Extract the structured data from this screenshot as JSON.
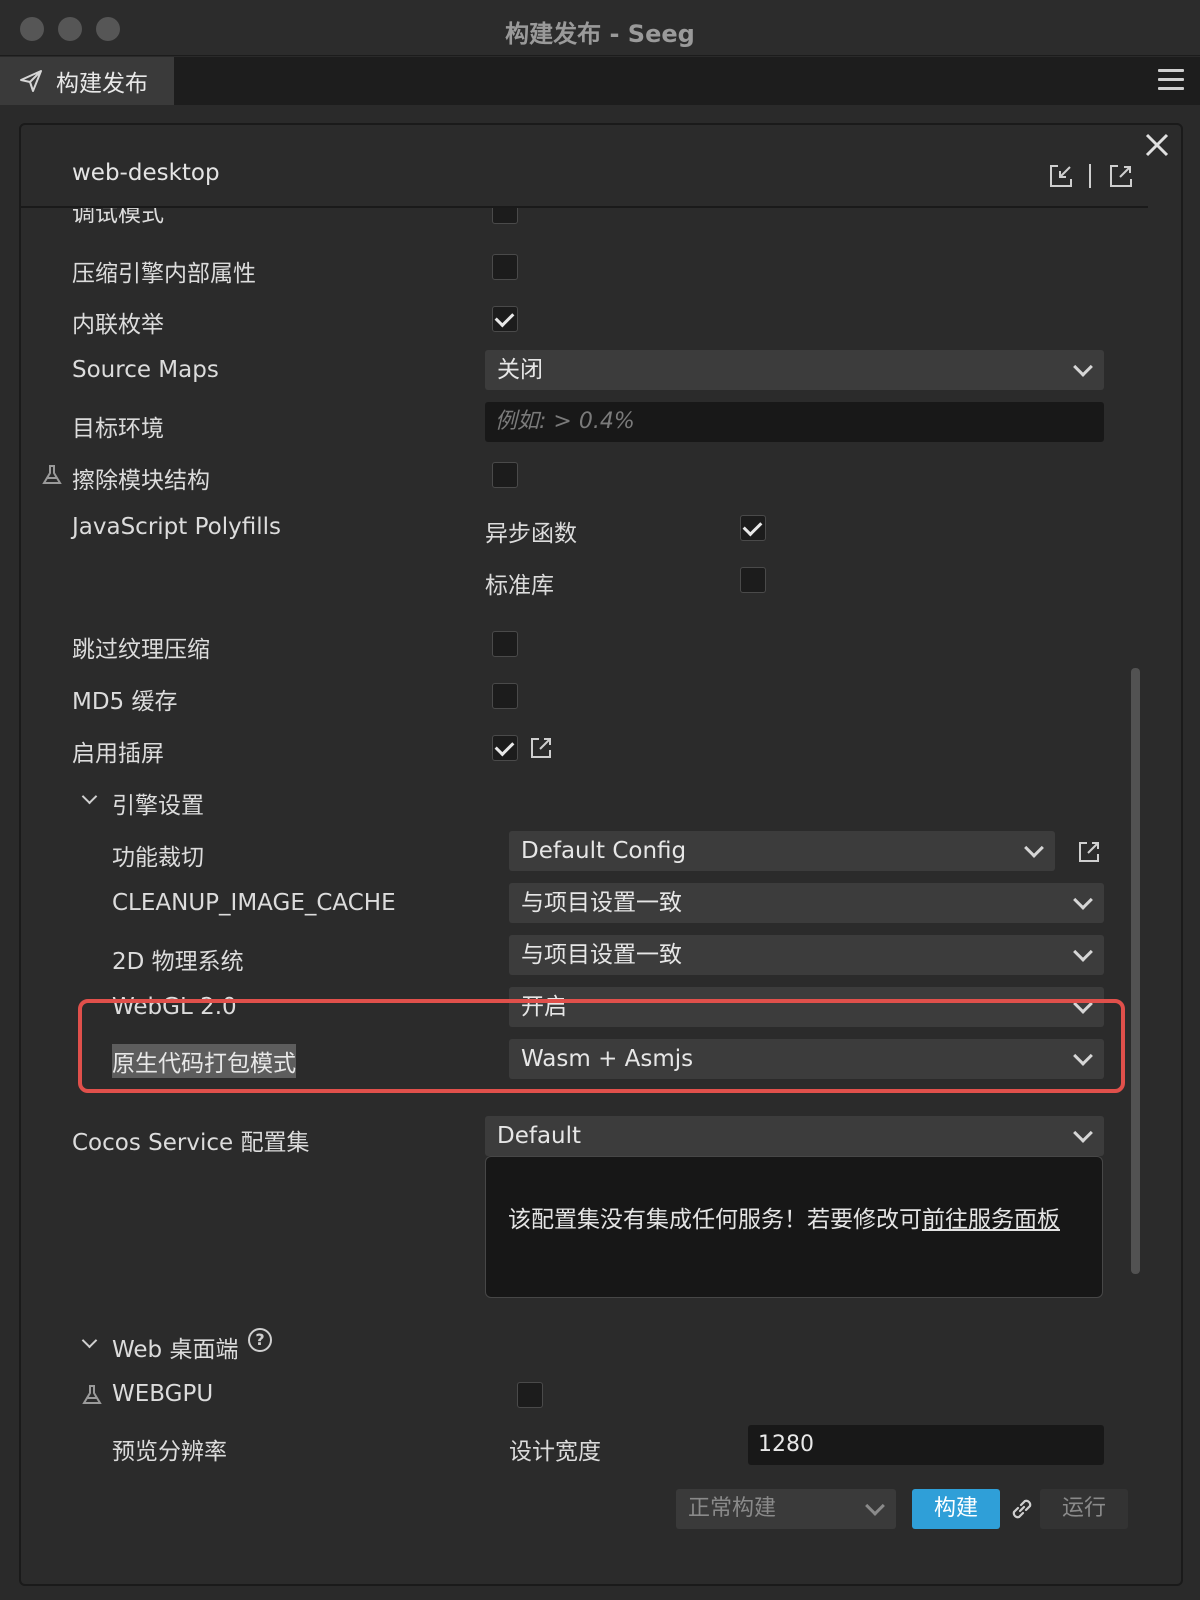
{
  "window": {
    "title": "构建发布 - Seeg"
  },
  "tab": {
    "label": "构建发布"
  },
  "panel": {
    "title": "web-desktop"
  },
  "rows": {
    "debug_mode": "调试模式",
    "compress_engine": "压缩引擎内部属性",
    "inline_enum": "内联枚举",
    "source_maps": "Source Maps",
    "source_maps_value": "关闭",
    "target_env": "目标环境",
    "target_env_placeholder": "例如: > 0.4%",
    "erase_module": "擦除模块结构",
    "js_polyfills": "JavaScript Polyfills",
    "async_func": "异步函数",
    "std_lib": "标准库",
    "skip_texture": "跳过纹理压缩",
    "md5_cache": "MD5 缓存",
    "splash": "启用插屏"
  },
  "engine": {
    "section": "引擎设置",
    "feature_crop": "功能裁切",
    "feature_crop_value": "Default Config",
    "cleanup_cache": "CLEANUP_IMAGE_CACHE",
    "cleanup_cache_value": "与项目设置一致",
    "physics_2d": "2D 物理系统",
    "physics_2d_value": "与项目设置一致",
    "webgl2": "WebGL 2.0",
    "webgl2_value": "开启",
    "native_pack": "原生代码打包模式",
    "native_pack_value": "Wasm + Asmjs"
  },
  "service": {
    "label": "Cocos Service 配置集",
    "value": "Default",
    "message": "该配置集没有集成任何服务！若要修改可",
    "link": "前往服务面板"
  },
  "web": {
    "section": "Web 桌面端",
    "webgpu": "WEBGPU",
    "preview_res": "预览分辨率",
    "design_width": "设计宽度",
    "design_width_value": "1280"
  },
  "footer": {
    "build_mode": "正常构建",
    "build": "构建",
    "run": "运行"
  },
  "checkbox_state": {
    "debug_mode": false,
    "compress_engine": false,
    "inline_enum": true,
    "erase_module": false,
    "async_func": true,
    "std_lib": false,
    "skip_texture": false,
    "md5_cache": false,
    "splash": true,
    "webgpu": false
  },
  "colors": {
    "accent": "#2f9fd8",
    "highlight": "#e0504b"
  }
}
